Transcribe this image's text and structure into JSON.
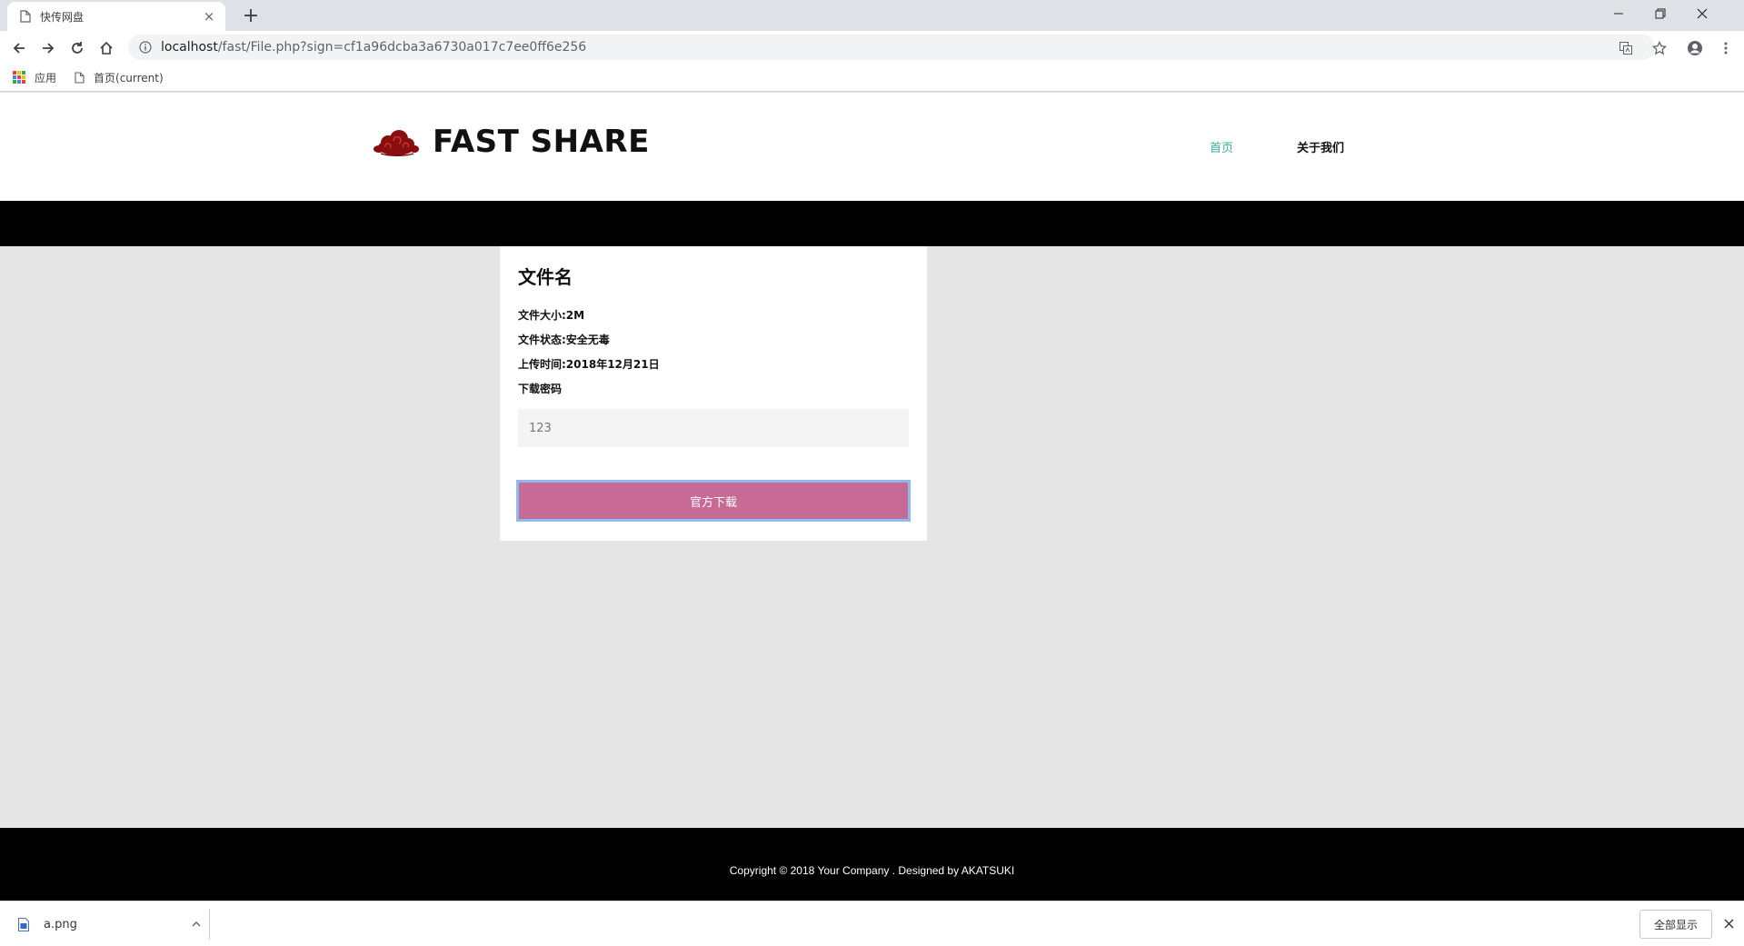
{
  "browser": {
    "tab_title": "快传网盘",
    "tab_close": "×",
    "new_tab": "+",
    "url_host": "localhost",
    "url_path": "/fast/File.php?sign=cf1a96dcba3a6730a017c7ee0ff6e256",
    "bookmarks": [
      {
        "label": "应用",
        "icon": "apps-grid-icon"
      },
      {
        "label": "首页(current)",
        "icon": "page-icon"
      }
    ]
  },
  "site": {
    "brand": "FAST SHARE",
    "nav": {
      "home": "首页",
      "about": "关于我们"
    },
    "colors": {
      "accent": "#3aaf9a",
      "button": "#c76b96",
      "logo": "#8b0d0d"
    }
  },
  "file": {
    "title": "文件名",
    "size": "文件大小:2M",
    "status": "文件状态:安全无毒",
    "upload_time": "上传时间:2018年12月21日",
    "password_label": "下载密码",
    "password_value": "123",
    "download_button": "官方下载"
  },
  "footer": {
    "copyright": "Copyright © 2018 Your Company . Designed by AKATSUKI"
  },
  "downloads": {
    "file_name": "a.png",
    "show_all": "全部显示"
  }
}
